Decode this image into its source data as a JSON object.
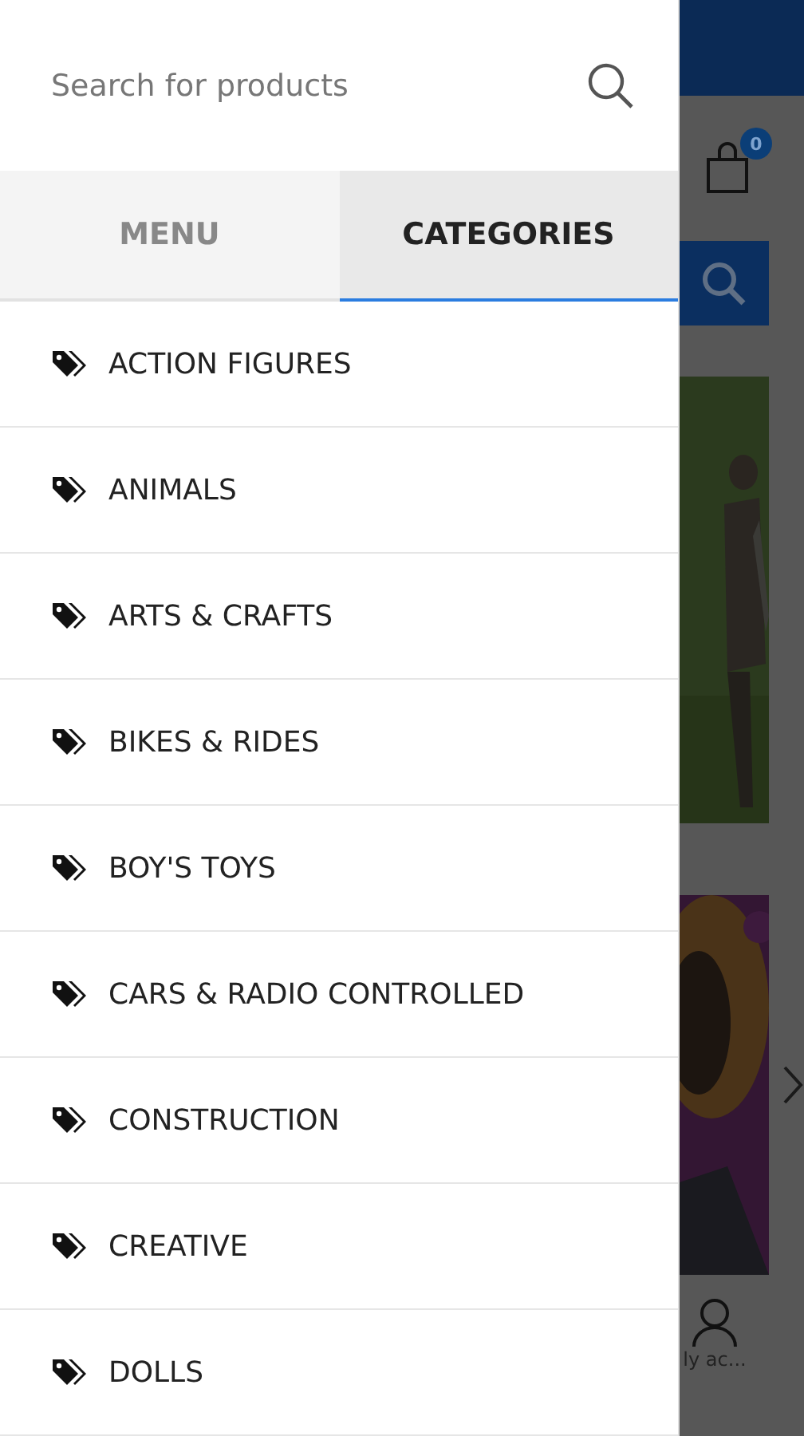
{
  "drawer": {
    "search": {
      "placeholder": "Search for products"
    },
    "tabs": [
      {
        "label": "MENU",
        "selected": false
      },
      {
        "label": "CATEGORIES",
        "selected": true
      }
    ],
    "categories": [
      {
        "label": "ACTION FIGURES"
      },
      {
        "label": "ANIMALS"
      },
      {
        "label": "ARTS & CRAFTS"
      },
      {
        "label": "BIKES & RIDES"
      },
      {
        "label": "BOY'S TOYS"
      },
      {
        "label": "CARS & RADIO CONTROLLED"
      },
      {
        "label": "CONSTRUCTION"
      },
      {
        "label": "CREATIVE"
      },
      {
        "label": "DOLLS"
      }
    ]
  },
  "page": {
    "cart_count": "0",
    "account_label": "ly ac..."
  }
}
